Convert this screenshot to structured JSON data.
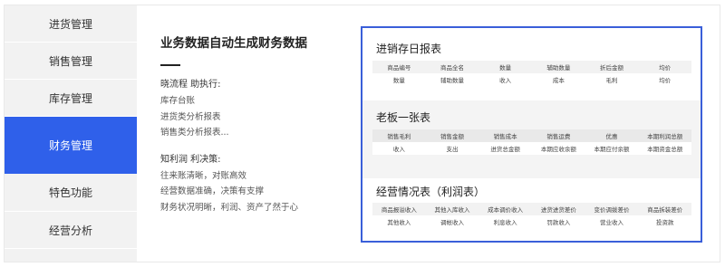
{
  "sidebar": {
    "items": [
      {
        "label": "进货管理",
        "active": false
      },
      {
        "label": "销售管理",
        "active": false
      },
      {
        "label": "库存管理",
        "active": false
      },
      {
        "label": "财务管理",
        "active": true
      },
      {
        "label": "特色功能",
        "active": false
      },
      {
        "label": "经营分析",
        "active": false
      }
    ]
  },
  "description": {
    "title": "业务数据自动生成财务数据",
    "group1": {
      "head": "晓流程 助执行:",
      "lines": [
        "库存台账",
        "进货类分析报表",
        "销售类分析报表..."
      ]
    },
    "group2": {
      "head": "知利润 利决策:",
      "lines": [
        "往来账清晰，对账高效",
        "经营数据准确，决策有支撑",
        "财务状况明晰，利润、资产了然于心"
      ]
    }
  },
  "reports": [
    {
      "title": "进销存日报表",
      "rows": [
        [
          "商品编号",
          "商品全名",
          "数量",
          "辅助数量",
          "折后金额",
          "均价"
        ],
        [
          "数量",
          "辅助数量",
          "收入",
          "成本",
          "毛利",
          "均价"
        ]
      ]
    },
    {
      "title": "老板一张表",
      "rows": [
        [
          "销售毛利",
          "销售金额",
          "销售成本",
          "销售运费",
          "优惠",
          "本期利润总额"
        ],
        [
          "收入",
          "支出",
          "进货总金额",
          "本期应收余额",
          "本期应付余额",
          "本期资金总额"
        ]
      ]
    },
    {
      "title": "经营情况表（利润表）",
      "rows": [
        [
          "商品报溢收入",
          "其他入库收入",
          "成本调价收入",
          "进货进货差价",
          "变价调拨差价",
          "商品拆装差价"
        ],
        [
          "其他收入",
          "调帐收入",
          "利息收入",
          "罚款收入",
          "营业收入",
          "投资款"
        ]
      ]
    }
  ],
  "colors": {
    "active_nav": "#2f60ea",
    "panel_border": "#3a5fd9",
    "sidebar_bg": "#f2f2f2"
  }
}
